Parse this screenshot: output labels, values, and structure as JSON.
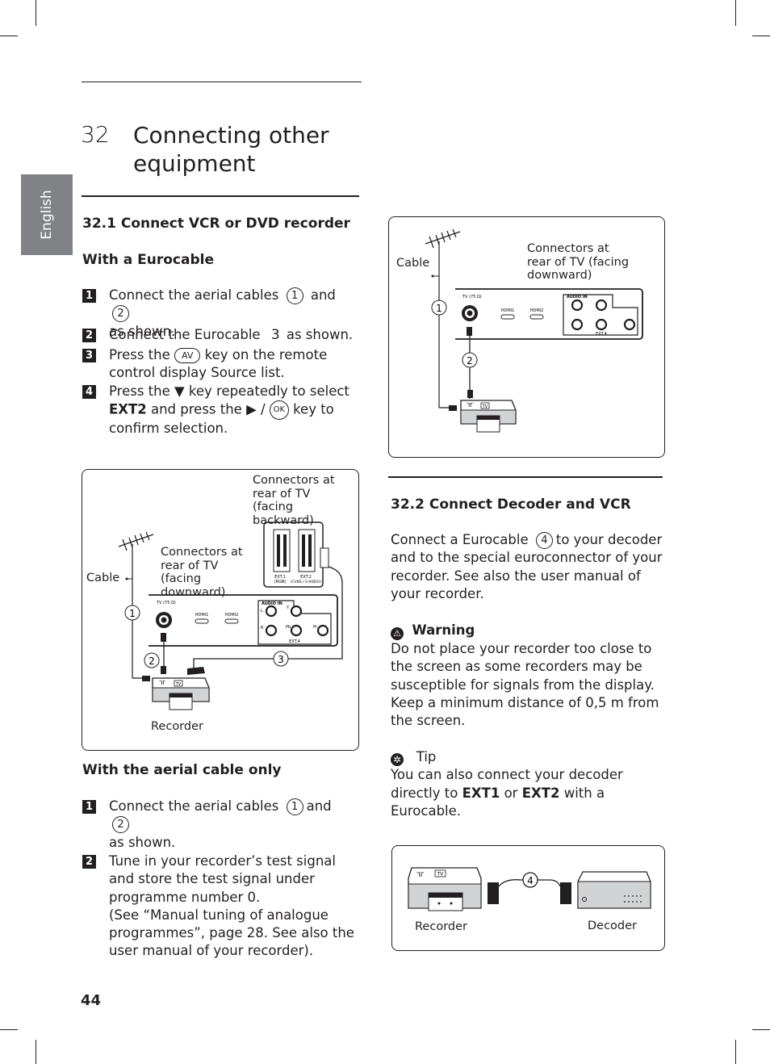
{
  "page": {
    "side_tab": "English",
    "page_number": "44"
  },
  "chapter": {
    "number": "32",
    "title": "Connecting other equipment"
  },
  "section_32_1": {
    "heading": "32.1  Connect VCR or DVD recorder",
    "subheading_eurocable": "With a Eurocable",
    "steps": [
      {
        "num": "1",
        "text_a": "Connect the aerial cables",
        "circle_a": "1",
        "text_b": "and",
        "circle_b": "2",
        "text_c": "as shown."
      },
      {
        "num": "2",
        "text_a": "Connect the Eurocable",
        "circle_a": "3",
        "text_b": "as shown."
      },
      {
        "num": "3",
        "text_a": "Press the",
        "key": "AV",
        "text_b": "key on the remote control display Source list."
      },
      {
        "num": "4",
        "text_a": "Press the ▼ key repeatedly to select",
        "bold": "EXT2",
        "text_b": "and press the ▶ /",
        "key": "OK",
        "text_c": "key to confirm selection."
      }
    ],
    "diagram1": {
      "label_backward": "Connectors at rear of TV (facing backward)",
      "label_downward": "Connectors at rear of TV (facing downward)",
      "label_cable": "Cable",
      "label_recorder": "Recorder",
      "markers": [
        "1",
        "2",
        "3"
      ],
      "port_labels": {
        "tv": "TV (75 Ω)",
        "hdmi1": "HDMI1",
        "hdmi2": "HDMI2",
        "audio_in": "AUDIO IN",
        "l": "L",
        "r": "R",
        "y": "Y",
        "pb": "Pb",
        "pr": "Pr",
        "ext4": "EXT.4",
        "ext1": "EXT.1",
        "ext1_sub": "(RGB)",
        "ext2": "EXT.2",
        "ext2_sub": "(CVBS / S-VIDEO)",
        "tv_badge": "TV"
      }
    },
    "subheading_aerial": "With the aerial cable only",
    "aerial_steps": [
      {
        "num": "1",
        "text_a": "Connect the aerial cables",
        "circle_a": "1",
        "text_b": "and",
        "circle_b": "2",
        "text_c": "as shown."
      },
      {
        "num": "2",
        "text": "Tune in your recorder’s test signal and store the test signal under programme number 0.",
        "text2": "(See “Manual tuning of analogue programmes”, page 28. See also the user manual of your recorder)."
      }
    ]
  },
  "diagram2": {
    "label_cable": "Cable",
    "label_downward": "Connectors at rear of TV (facing downward)",
    "markers": [
      "1",
      "2"
    ]
  },
  "section_32_2": {
    "heading": "32.2   Connect Decoder and VCR",
    "intro_a": "Connect a Eurocable",
    "intro_circle": "4",
    "intro_b": "to your decoder and to the special euroconnector of your recorder. See also the user manual of your recorder.",
    "warning": {
      "icon": "warning-icon",
      "title": "Warning",
      "text": "Do not place your recorder too close to the screen as some recorders may be susceptible for signals from the display. Keep a minimum distance of  0,5 m from the screen."
    },
    "tip": {
      "icon": "tip-icon",
      "title": "Tip",
      "text_a": "You can also connect your decoder directly to",
      "bold1": "EXT1",
      "text_b": "or",
      "bold2": "EXT2",
      "text_c": "with a Eurocable."
    }
  },
  "diagram3": {
    "label_recorder": "Recorder",
    "label_decoder": "Decoder",
    "marker": "4"
  }
}
